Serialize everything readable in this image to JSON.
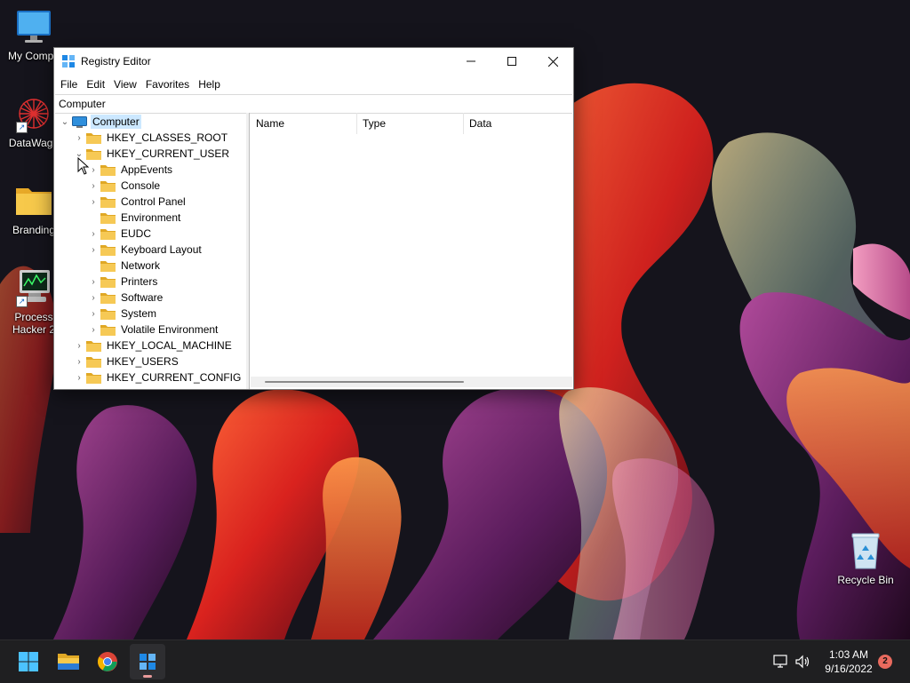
{
  "desktop": {
    "icons": [
      {
        "label": "My Compu",
        "icon": "monitor-icon",
        "shortcut": false
      },
      {
        "label": "DataWago",
        "icon": "datawagon-icon",
        "shortcut": true
      },
      {
        "label": "Branding",
        "icon": "folder-icon",
        "shortcut": false
      },
      {
        "label": "Process\nHacker 2",
        "icon": "process-hacker-icon",
        "shortcut": true
      },
      {
        "label": "Recycle Bin",
        "icon": "recycle-bin-icon",
        "shortcut": false
      }
    ]
  },
  "window": {
    "title": "Registry Editor",
    "menu": [
      "File",
      "Edit",
      "View",
      "Favorites",
      "Help"
    ],
    "address": "Computer",
    "tree": {
      "root": "Computer",
      "hives": [
        {
          "label": "HKEY_CLASSES_ROOT",
          "expanded": false
        },
        {
          "label": "HKEY_CURRENT_USER",
          "expanded": true,
          "children": [
            {
              "label": "AppEvents",
              "has_children": true
            },
            {
              "label": "Console",
              "has_children": true
            },
            {
              "label": "Control Panel",
              "has_children": true
            },
            {
              "label": "Environment",
              "has_children": false
            },
            {
              "label": "EUDC",
              "has_children": true
            },
            {
              "label": "Keyboard Layout",
              "has_children": true
            },
            {
              "label": "Network",
              "has_children": false
            },
            {
              "label": "Printers",
              "has_children": true
            },
            {
              "label": "Software",
              "has_children": true
            },
            {
              "label": "System",
              "has_children": true
            },
            {
              "label": "Volatile Environment",
              "has_children": true
            }
          ]
        },
        {
          "label": "HKEY_LOCAL_MACHINE",
          "expanded": false
        },
        {
          "label": "HKEY_USERS",
          "expanded": false
        },
        {
          "label": "HKEY_CURRENT_CONFIG",
          "expanded": false
        }
      ]
    },
    "columns": [
      "Name",
      "Type",
      "Data"
    ]
  },
  "taskbar": {
    "apps": [
      "start-icon",
      "file-explorer-icon",
      "chrome-icon",
      "registry-editor-icon"
    ],
    "active_app": "registry-editor-icon",
    "clock_time": "1:03 AM",
    "clock_date": "9/16/2022",
    "notification_count": "2"
  },
  "colors": {
    "selection": "#cce8ff",
    "folder": "#f3c44a",
    "taskbar": "#1f1f21",
    "accent": "#0067c0"
  }
}
